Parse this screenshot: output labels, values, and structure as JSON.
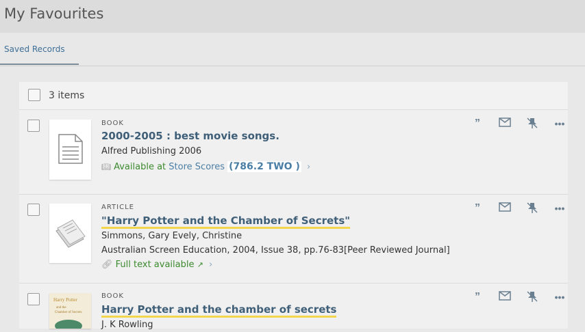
{
  "page": {
    "title": "My Favourites"
  },
  "tabs": [
    {
      "label": "Saved Records"
    }
  ],
  "list": {
    "count_label": "3 items"
  },
  "records": [
    {
      "type": "BOOK",
      "title": "2000-2005 : best movie songs.",
      "meta1": "Alfred Publishing 2006",
      "availability": {
        "status": "Available at",
        "location": "Store Scores",
        "call_number": "(786.2 TWO )"
      }
    },
    {
      "type": "ARTICLE",
      "title": "\"Harry Potter and the Chamber of Secrets\"",
      "meta1": "Simmons, Gary Evely, Christine",
      "meta2": "Australian Screen Education, 2004, Issue 38, pp.76-83[Peer Reviewed Journal]",
      "availability": {
        "status": "Full text available"
      }
    },
    {
      "type": "BOOK",
      "title": "Harry Potter and the chamber of secrets",
      "meta1": "J. K Rowling"
    }
  ],
  "icons": [
    "quote-icon",
    "email-icon",
    "unpin-icon",
    "more-icon",
    "book-icon",
    "link-icon",
    "external-link-icon",
    "chevron-right-icon"
  ],
  "colors": {
    "header_bg": "#dcdcdc",
    "link": "#3f5f78",
    "available": "#3c8a2e",
    "highlight": "#f2d64b"
  }
}
